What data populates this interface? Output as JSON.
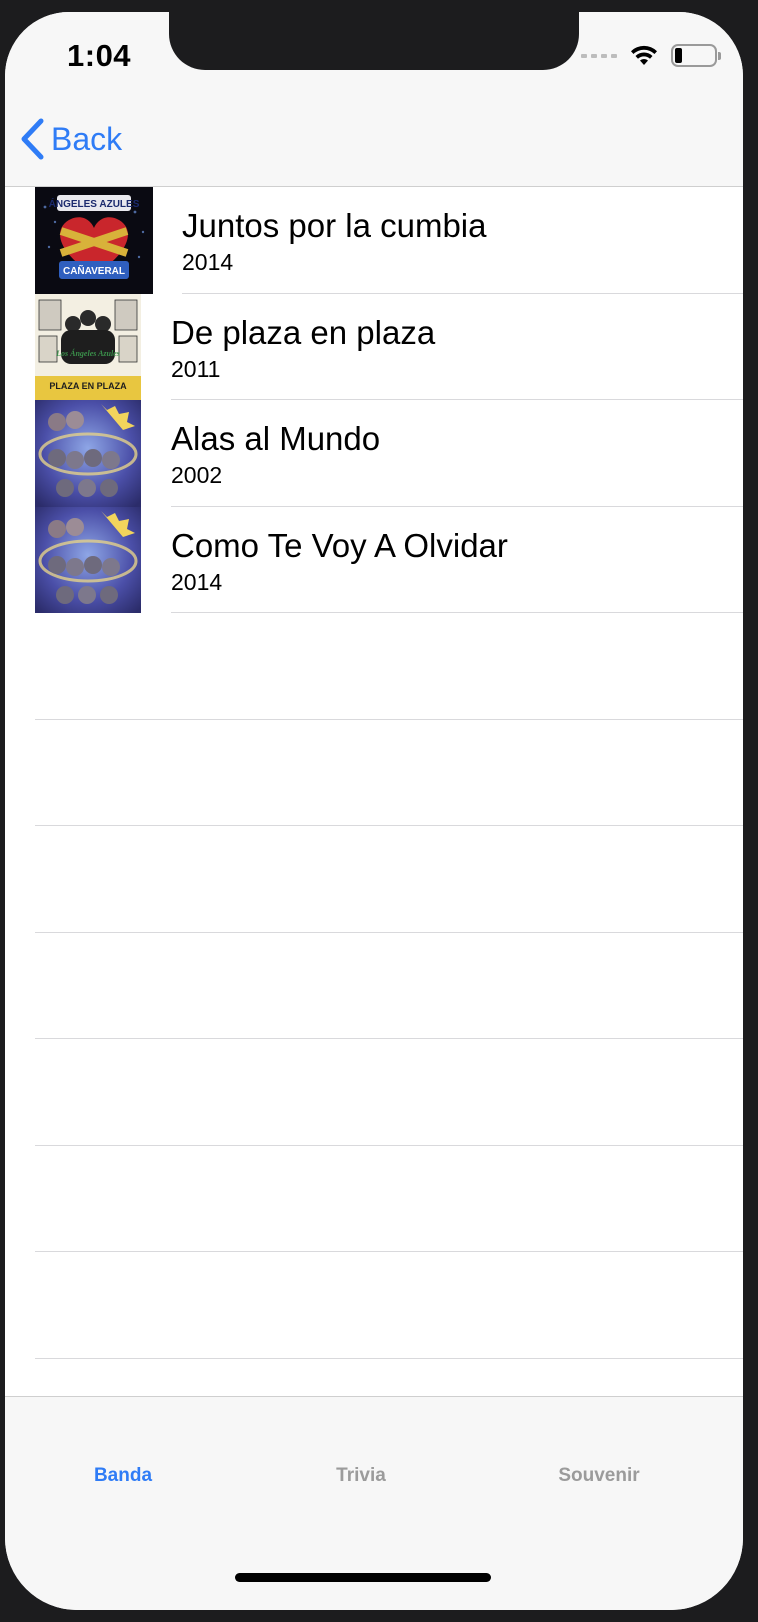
{
  "status_bar": {
    "time": "1:04"
  },
  "nav": {
    "back_label": "Back"
  },
  "albums": [
    {
      "title": "Juntos por la cumbia",
      "year": "2014",
      "art_logo": "ÁNGELES AZULES",
      "art_sub": "CAÑAVERAL"
    },
    {
      "title": "De plaza en plaza",
      "year": "2011",
      "art_logo": "Los Ángeles Azules",
      "art_sub": "PLAZA EN PLAZA"
    },
    {
      "title": "Alas al Mundo",
      "year": "2002"
    },
    {
      "title": "Como Te Voy A Olvidar",
      "year": "2014"
    }
  ],
  "tabs": [
    {
      "label": "Banda",
      "active": true
    },
    {
      "label": "Trivia",
      "active": false
    },
    {
      "label": "Souvenir",
      "active": false
    }
  ],
  "colors": {
    "accent": "#2f7cf6",
    "inactive_tab": "#9b9b9b",
    "separator": "#d9d9dc"
  }
}
